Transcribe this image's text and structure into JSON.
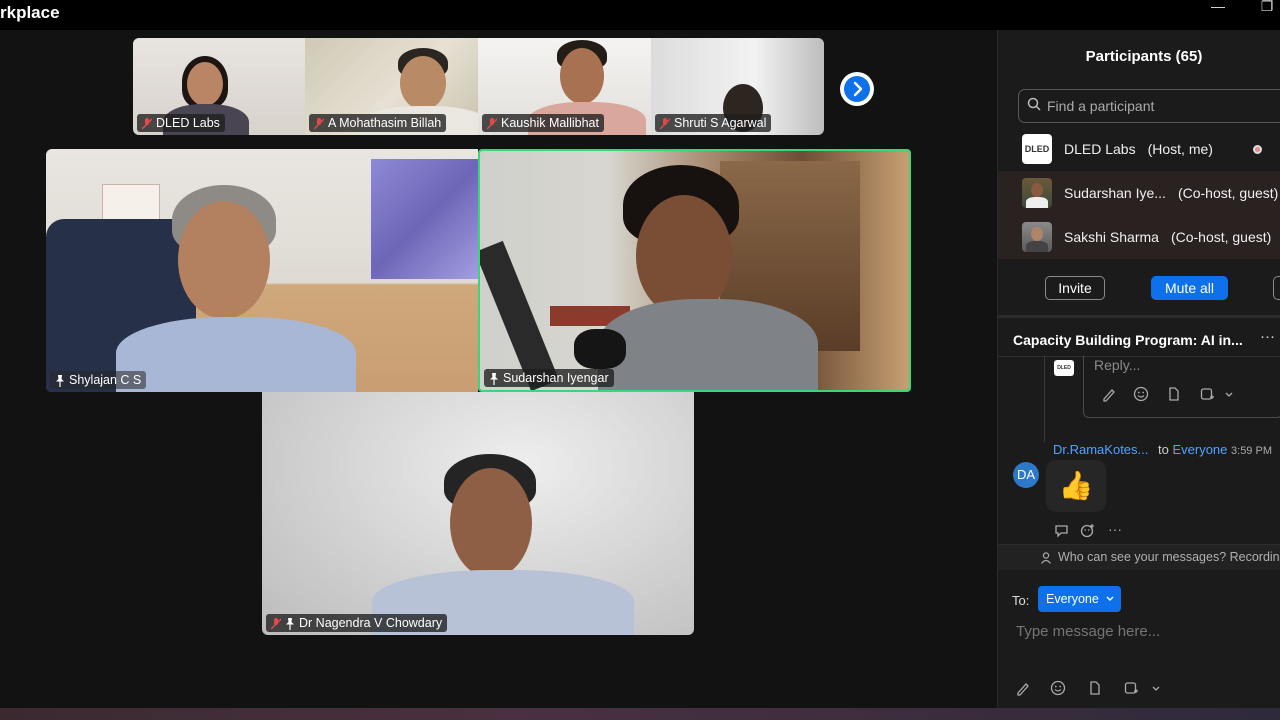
{
  "app": {
    "title": "rkplace"
  },
  "window": {
    "minimize_glyph": "—",
    "restore_glyph": "❐"
  },
  "gallery": {
    "top_strip": [
      {
        "name": "DLED Labs",
        "muted": true
      },
      {
        "name": "A Mohathasim Billah",
        "muted": true
      },
      {
        "name": "Kaushik Mallibhat",
        "muted": true
      },
      {
        "name": "Shruti S Agarwal",
        "muted": true
      }
    ],
    "main_tiles": [
      {
        "name": "Shylajan C S",
        "pinned": true,
        "muted": false
      },
      {
        "name": "Sudarshan Iyengar",
        "pinned": true,
        "muted": false,
        "active_speaker": true
      },
      {
        "name": "Dr Nagendra V Chowdary",
        "pinned": true,
        "muted": true
      }
    ],
    "next_page_icon": "chevron-right-icon"
  },
  "participants": {
    "title": "Participants (65)",
    "search_placeholder": "Find a participant",
    "list": [
      {
        "name": "DLED Labs",
        "role": "(Host, me)",
        "avatar_text": "DLED"
      },
      {
        "name": "Sudarshan Iye...",
        "role": "(Co-host, guest)"
      },
      {
        "name": "Sakshi Sharma",
        "role": "(Co-host, guest)"
      }
    ],
    "invite_label": "Invite",
    "mute_all_label": "Mute all"
  },
  "chat": {
    "title": "Capacity Building Program: AI in...",
    "more_glyph": "···",
    "thread_avatar_text": "DLED",
    "reply_placeholder": "Reply...",
    "message": {
      "avatar": "DA",
      "sender": "Dr.RamaKotes...",
      "to_label": "to",
      "recipient": "Everyone",
      "time": "3:59 PM",
      "emoji": "👍"
    },
    "more_actions_glyph": "···",
    "privacy_notice": "Who can see your messages? Recording",
    "to_prefix": "To:",
    "to_value": "Everyone",
    "input_placeholder": "Type message here...",
    "accent_color": "#0e71eb",
    "link_color": "#4fa3ff"
  }
}
